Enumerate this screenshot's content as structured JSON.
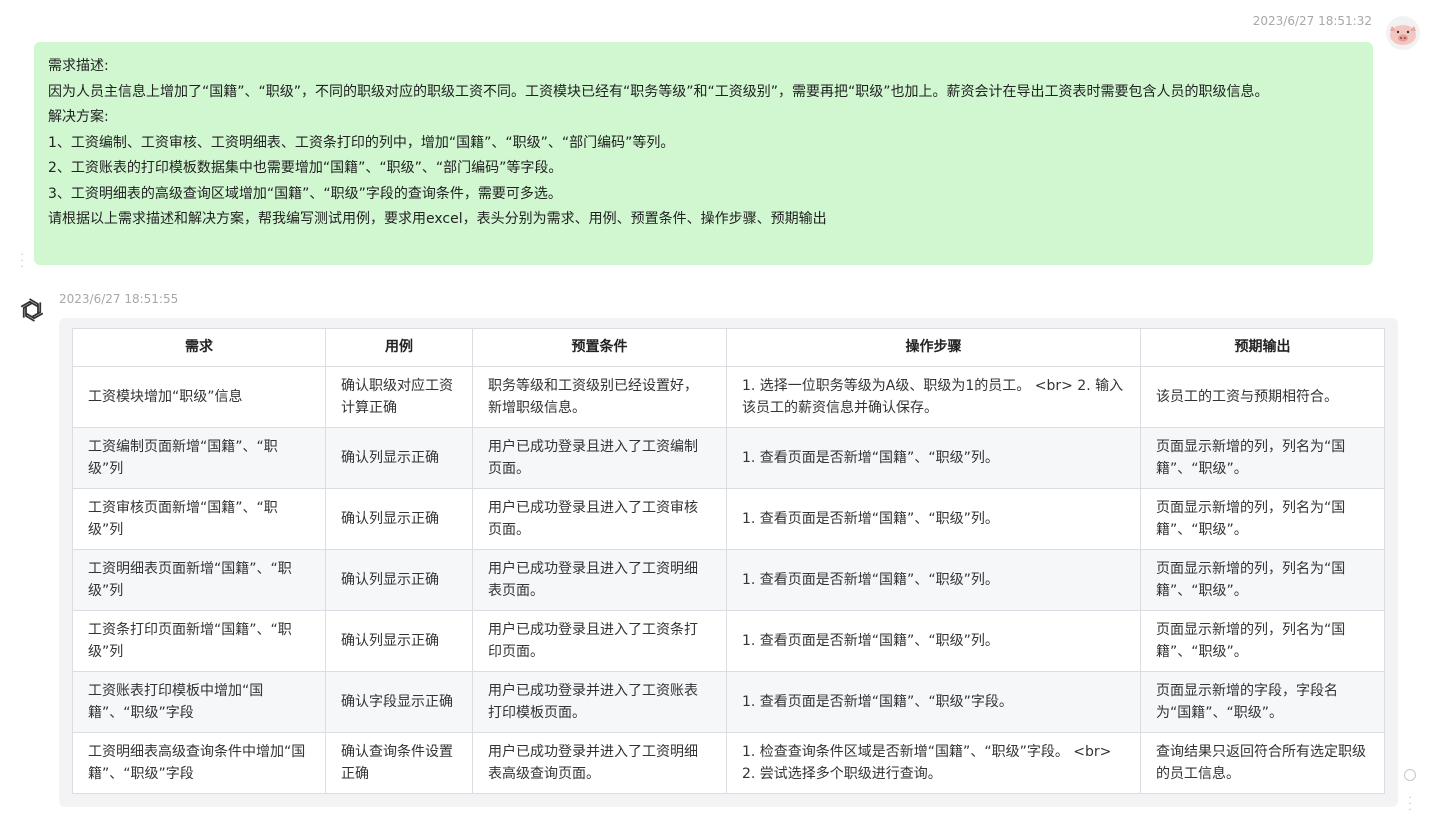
{
  "user_message": {
    "timestamp": "2023/6/27 18:51:32",
    "lines": [
      "需求描述:",
      "因为人员主信息上增加了“国籍”、“职级”，不同的职级对应的职级工资不同。工资模块已经有“职务等级”和“工资级别”，需要再把“职级”也加上。薪资会计在导出工资表时需要包含人员的职级信息。",
      "解决方案:",
      "1、工资编制、工资审核、工资明细表、工资条打印的列中，增加“国籍”、“职级”、“部门编码”等列。",
      "2、工资账表的打印模板数据集中也需要增加“国籍”、“职级”、“部门编码”等字段。",
      "3、工资明细表的高级查询区域增加“国籍”、“职级”字段的查询条件，需要可多选。",
      "请根据以上需求描述和解决方案，帮我编写测试用例，要求用excel，表头分别为需求、用例、预置条件、操作步骤、预期输出"
    ]
  },
  "assistant_message": {
    "timestamp": "2023/6/27 18:51:55",
    "table": {
      "headers": [
        "需求",
        "用例",
        "预置条件",
        "操作步骤",
        "预期输出"
      ],
      "rows": [
        [
          "工资模块增加“职级”信息",
          "确认职级对应工资计算正确",
          "职务等级和工资级别已经设置好，新增职级信息。",
          "1. 选择一位职务等级为A级、职级为1的员工。 <br> 2. 输入该员工的薪资信息并确认保存。",
          "该员工的工资与预期相符合。"
        ],
        [
          "工资编制页面新增“国籍”、“职级”列",
          "确认列显示正确",
          "用户已成功登录且进入了工资编制页面。",
          "1. 查看页面是否新增“国籍”、“职级”列。",
          "页面显示新增的列，列名为“国籍”、“职级”。"
        ],
        [
          "工资审核页面新增“国籍”、“职级”列",
          "确认列显示正确",
          "用户已成功登录且进入了工资审核页面。",
          "1. 查看页面是否新增“国籍”、“职级”列。",
          "页面显示新增的列，列名为“国籍”、“职级”。"
        ],
        [
          "工资明细表页面新增“国籍”、“职级”列",
          "确认列显示正确",
          "用户已成功登录且进入了工资明细表页面。",
          "1. 查看页面是否新增“国籍”、“职级”列。",
          "页面显示新增的列，列名为“国籍”、“职级”。"
        ],
        [
          "工资条打印页面新增“国籍”、“职级”列",
          "确认列显示正确",
          "用户已成功登录且进入了工资条打印页面。",
          "1. 查看页面是否新增“国籍”、“职级”列。",
          "页面显示新增的列，列名为“国籍”、“职级”。"
        ],
        [
          "工资账表打印模板中增加“国籍”、“职级”字段",
          "确认字段显示正确",
          "用户已成功登录并进入了工资账表打印模板页面。",
          "1. 查看页面是否新增“国籍”、“职级”字段。",
          "页面显示新增的字段，字段名为“国籍”、“职级”。"
        ],
        [
          "工资明细表高级查询条件中增加“国籍”、“职级”字段",
          "确认查询条件设置正确",
          "用户已成功登录并进入了工资明细表高级查询页面。",
          "1. 检查查询条件区域是否新增“国籍”、“职级”字段。 <br> 2. 尝试选择多个职级进行查询。",
          "查询结果只返回符合所有选定职级的员工信息。"
        ]
      ]
    }
  },
  "icons": {
    "user_avatar": "pig-avatar-icon",
    "assistant_avatar": "openai-logo-icon",
    "more": "vertical-dots-icon",
    "scroll": "circle-icon"
  }
}
